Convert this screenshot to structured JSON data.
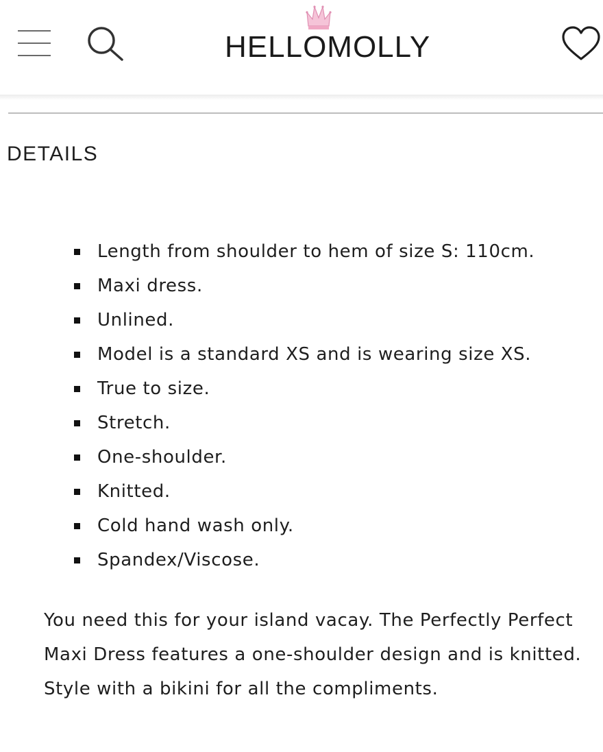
{
  "header": {
    "logo_text": "HELLOMOLLY",
    "icons": {
      "menu": "hamburger-menu-icon",
      "search": "search-icon",
      "logo_mark": "crown-icon",
      "wishlist": "heart-icon"
    },
    "colors": {
      "crown_accent": "#f0a8c4",
      "icon_gray": "#6a6a6a"
    }
  },
  "details": {
    "title": "DETAILS",
    "items": [
      "Length from shoulder to hem of size S: 110cm.",
      "Maxi dress.",
      "Unlined.",
      "Model is a standard XS and is wearing size XS.",
      "True to size.",
      "Stretch.",
      "One-shoulder.",
      "Knitted.",
      "Cold hand wash only.",
      "Spandex/Viscose."
    ],
    "description": "You need this for your island vacay. The Perfectly Perfect Maxi Dress features a one-shoulder design and is knitted. Style with a bikini for all the compliments."
  }
}
